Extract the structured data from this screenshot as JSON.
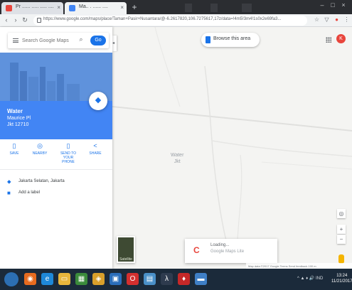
{
  "browser": {
    "tabs": [
      {
        "label": "Pr ...... ..... ..... ....",
        "active": false,
        "favicon_color": "#e8453c"
      },
      {
        "label": "Ma.. . ...... ....",
        "active": true,
        "favicon_color": "#4285f4"
      }
    ],
    "url": "https://www.google.com/maps/place/Taman+Pasir+Nusantara/@-6.2617820,106.7275617,17z/data=!4m5!3m4!1s0x2e69fa3...",
    "back_icon": "back-arrow-icon",
    "forward_icon": "forward-arrow-icon",
    "reload_icon": "reload-icon"
  },
  "panel": {
    "search_placeholder": "Search Google Maps",
    "directions_label": "Go",
    "place": {
      "name": "Water",
      "address_line1": "Maurice Pl",
      "address_line2": "Jkt 12710"
    },
    "fab_label": "Directions",
    "actions": [
      {
        "label": "SAVE",
        "icon": "bookmark-icon",
        "glyph": "▯"
      },
      {
        "label": "NEARBY",
        "icon": "nearby-icon",
        "glyph": "◎"
      },
      {
        "label": "SEND TO YOUR PHONE",
        "icon": "phone-icon",
        "glyph": "▯"
      },
      {
        "label": "SHARE",
        "icon": "share-icon",
        "glyph": "<"
      }
    ],
    "info_rows": [
      {
        "text": "Jakarta Selatan, Jakarta",
        "icon": "location-pin-icon",
        "glyph": "📍"
      },
      {
        "text": "Add a label",
        "icon": "label-icon",
        "glyph": "■"
      }
    ]
  },
  "map": {
    "place_label_line1": "Water",
    "place_label_line2": "Jkt",
    "search_chip": "Browse this area",
    "avatar_letter": "K",
    "satellite_label": "Satellite",
    "toast": {
      "title": "Loading...",
      "subtitle": "Google Maps Lite"
    },
    "attribution": "Map data ©2017 Google  Terms  Send feedback  100 m",
    "zoom_in": "+",
    "zoom_out": "−",
    "locate_glyph": "◎"
  },
  "taskbar": {
    "tray_text": "^ ▲ ♦ 🔊 IND",
    "time": "13:24",
    "date": "11/21/2017"
  }
}
